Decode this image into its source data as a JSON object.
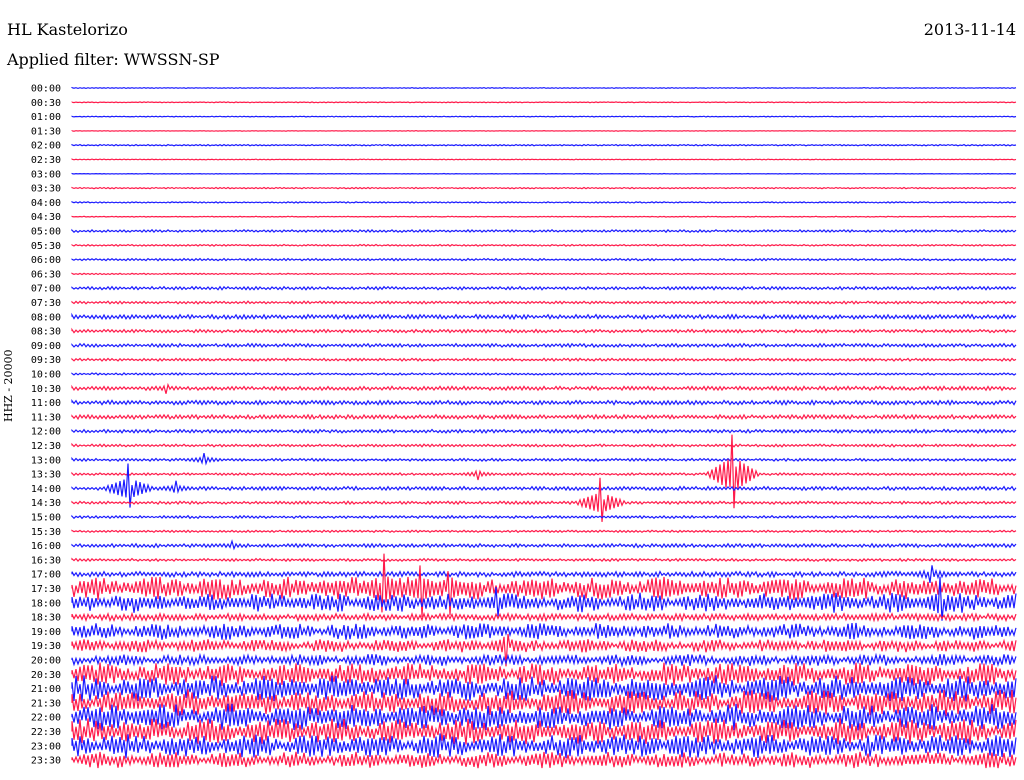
{
  "header": {
    "station": "HL Kastelorizo",
    "date": "2013-11-14",
    "filter": "Applied filter: WWSSN-SP"
  },
  "ylabel": "HHZ - 20000",
  "colors": {
    "blue": "#1a1aff",
    "red": "#ff1a4a"
  },
  "chart_data": {
    "type": "helicorder",
    "title": "HL Kastelorizo",
    "subtitle": "Applied filter: WWSSN-SP",
    "ylabel": "HHZ - 20000",
    "row_interval_minutes": 30,
    "color_cycle": [
      "blue",
      "red"
    ],
    "rows": [
      {
        "time": "00:00",
        "amplitude": 0.3
      },
      {
        "time": "00:30",
        "amplitude": 0.3
      },
      {
        "time": "01:00",
        "amplitude": 0.3
      },
      {
        "time": "01:30",
        "amplitude": 0.2
      },
      {
        "time": "02:00",
        "amplitude": 0.5
      },
      {
        "time": "02:30",
        "amplitude": 0.3
      },
      {
        "time": "03:00",
        "amplitude": 0.2
      },
      {
        "time": "03:30",
        "amplitude": 0.5
      },
      {
        "time": "04:00",
        "amplitude": 0.5
      },
      {
        "time": "04:30",
        "amplitude": 0.3
      },
      {
        "time": "05:00",
        "amplitude": 0.9
      },
      {
        "time": "05:30",
        "amplitude": 0.6
      },
      {
        "time": "06:00",
        "amplitude": 0.8
      },
      {
        "time": "06:30",
        "amplitude": 0.5
      },
      {
        "time": "07:00",
        "amplitude": 1.2
      },
      {
        "time": "07:30",
        "amplitude": 1.0
      },
      {
        "time": "08:00",
        "amplitude": 1.6
      },
      {
        "time": "08:30",
        "amplitude": 1.2
      },
      {
        "time": "09:00",
        "amplitude": 1.3
      },
      {
        "time": "09:30",
        "amplitude": 1.0
      },
      {
        "time": "10:00",
        "amplitude": 0.8
      },
      {
        "time": "10:30",
        "amplitude": 1.5
      },
      {
        "time": "11:00",
        "amplitude": 1.6
      },
      {
        "time": "11:30",
        "amplitude": 1.6
      },
      {
        "time": "12:00",
        "amplitude": 1.3
      },
      {
        "time": "12:30",
        "amplitude": 1.0
      },
      {
        "time": "13:00",
        "amplitude": 1.0
      },
      {
        "time": "13:30",
        "amplitude": 0.9
      },
      {
        "time": "14:00",
        "amplitude": 1.4
      },
      {
        "time": "14:30",
        "amplitude": 1.1
      },
      {
        "time": "15:00",
        "amplitude": 1.0
      },
      {
        "time": "15:30",
        "amplitude": 0.8
      },
      {
        "time": "16:00",
        "amplitude": 1.4
      },
      {
        "time": "16:30",
        "amplitude": 1.0
      },
      {
        "time": "17:00",
        "amplitude": 2.0
      },
      {
        "time": "17:30",
        "amplitude": 7.0
      },
      {
        "time": "18:00",
        "amplitude": 6.0
      },
      {
        "time": "18:30",
        "amplitude": 2.6
      },
      {
        "time": "19:00",
        "amplitude": 5.0
      },
      {
        "time": "19:30",
        "amplitude": 4.0
      },
      {
        "time": "20:00",
        "amplitude": 3.5
      },
      {
        "time": "20:30",
        "amplitude": 7.0
      },
      {
        "time": "21:00",
        "amplitude": 8.0
      },
      {
        "time": "21:30",
        "amplitude": 8.0
      },
      {
        "time": "22:00",
        "amplitude": 8.0
      },
      {
        "time": "22:30",
        "amplitude": 8.0
      },
      {
        "time": "23:00",
        "amplitude": 7.5
      },
      {
        "time": "23:30",
        "amplitude": 5.0
      }
    ],
    "events": [
      {
        "time": "10:30",
        "pos": 0.1,
        "amplitude": 6
      },
      {
        "time": "13:00",
        "pos": 0.14,
        "amplitude": 7
      },
      {
        "time": "14:00",
        "pos": 0.06,
        "amplitude": 30
      },
      {
        "time": "14:00",
        "pos": 0.11,
        "amplitude": 8
      },
      {
        "time": "13:30",
        "pos": 0.43,
        "amplitude": 6
      },
      {
        "time": "14:30",
        "pos": 0.56,
        "amplitude": 30
      },
      {
        "time": "13:30",
        "pos": 0.7,
        "amplitude": 50
      },
      {
        "time": "16:00",
        "pos": 0.17,
        "amplitude": 5
      },
      {
        "time": "17:00",
        "pos": 0.91,
        "amplitude": 12
      },
      {
        "time": "17:30",
        "pos": 0.33,
        "amplitude": 40
      },
      {
        "time": "17:30",
        "pos": 0.37,
        "amplitude": 35
      },
      {
        "time": "17:30",
        "pos": 0.4,
        "amplitude": 30
      },
      {
        "time": "18:00",
        "pos": 0.45,
        "amplitude": 20
      },
      {
        "time": "19:30",
        "pos": 0.46,
        "amplitude": 22
      },
      {
        "time": "18:00",
        "pos": 0.92,
        "amplitude": 30
      }
    ]
  }
}
